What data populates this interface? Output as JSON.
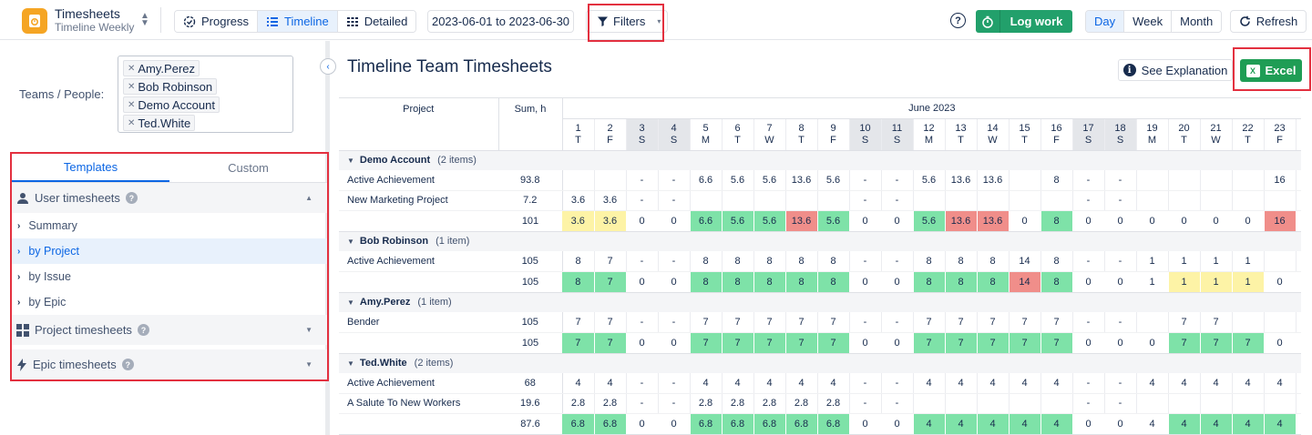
{
  "app": {
    "title": "Timesheets",
    "subtitle": "Timeline Weekly"
  },
  "views": [
    {
      "label": "Progress",
      "active": false
    },
    {
      "label": "Timeline",
      "active": true
    },
    {
      "label": "Detailed",
      "active": false
    }
  ],
  "date_range": "2023-06-01 to 2023-06-30",
  "filters_label": "Filters",
  "log_work_label": "Log work",
  "periods": [
    {
      "label": "Day",
      "active": true
    },
    {
      "label": "Week",
      "active": false
    },
    {
      "label": "Month",
      "active": false
    }
  ],
  "refresh_label": "Refresh",
  "teams_label": "Teams / People:",
  "people": [
    "Amy.Perez",
    "Bob Robinson",
    "Demo Account",
    "Ted.White"
  ],
  "tabs": [
    {
      "label": "Templates",
      "active": true
    },
    {
      "label": "Custom",
      "active": false
    }
  ],
  "groups": {
    "user": "User timesheets",
    "project": "Project timesheets",
    "epic": "Epic timesheets"
  },
  "template_items": [
    {
      "label": "Summary",
      "active": false
    },
    {
      "label": "by Project",
      "active": true
    },
    {
      "label": "by Issue",
      "active": false
    },
    {
      "label": "by Epic",
      "active": false
    }
  ],
  "main": {
    "title": "Timeline Team Timesheets",
    "see_explanation": "See Explanation",
    "excel_label": "Excel"
  },
  "grid": {
    "project_header": "Project",
    "sum_header": "Sum, h",
    "month": "June 2023",
    "days": [
      {
        "d": "1",
        "w": "T",
        "we": false
      },
      {
        "d": "2",
        "w": "F",
        "we": false
      },
      {
        "d": "3",
        "w": "S",
        "we": true
      },
      {
        "d": "4",
        "w": "S",
        "we": true
      },
      {
        "d": "5",
        "w": "M",
        "we": false
      },
      {
        "d": "6",
        "w": "T",
        "we": false
      },
      {
        "d": "7",
        "w": "W",
        "we": false
      },
      {
        "d": "8",
        "w": "T",
        "we": false
      },
      {
        "d": "9",
        "w": "F",
        "we": false
      },
      {
        "d": "10",
        "w": "S",
        "we": true
      },
      {
        "d": "11",
        "w": "S",
        "we": true
      },
      {
        "d": "12",
        "w": "M",
        "we": false
      },
      {
        "d": "13",
        "w": "T",
        "we": false
      },
      {
        "d": "14",
        "w": "W",
        "we": false
      },
      {
        "d": "15",
        "w": "T",
        "we": false
      },
      {
        "d": "16",
        "w": "F",
        "we": false
      },
      {
        "d": "17",
        "w": "S",
        "we": true
      },
      {
        "d": "18",
        "w": "S",
        "we": true
      },
      {
        "d": "19",
        "w": "M",
        "we": false
      },
      {
        "d": "20",
        "w": "T",
        "we": false
      },
      {
        "d": "21",
        "w": "W",
        "we": false
      },
      {
        "d": "22",
        "w": "T",
        "we": false
      },
      {
        "d": "23",
        "w": "F",
        "we": false
      }
    ],
    "sections": [
      {
        "name": "Demo Account",
        "count": "(2 items)",
        "rows": [
          {
            "project": "Active Achievement",
            "sum": "93.8",
            "cells": [
              "",
              "",
              "-",
              "-",
              "6.6",
              "5.6",
              "5.6",
              "13.6",
              "5.6",
              "-",
              "-",
              "5.6",
              "13.6",
              "13.6",
              "",
              "8",
              "-",
              "-",
              "",
              "",
              "",
              "",
              "16"
            ]
          },
          {
            "project": "New Marketing Project",
            "sum": "7.2",
            "cells": [
              "3.6",
              "3.6",
              "-",
              "-",
              "",
              "",
              "",
              "",
              "",
              "-",
              "-",
              "",
              "",
              "",
              "",
              "",
              "-",
              "-",
              "",
              "",
              "",
              "",
              ""
            ]
          }
        ],
        "total": {
          "sum": "101",
          "cells": [
            {
              "v": "3.6",
              "c": "yellow"
            },
            {
              "v": "3.6",
              "c": "yellow"
            },
            {
              "v": "0",
              "c": ""
            },
            {
              "v": "0",
              "c": ""
            },
            {
              "v": "6.6",
              "c": "green"
            },
            {
              "v": "5.6",
              "c": "green"
            },
            {
              "v": "5.6",
              "c": "green"
            },
            {
              "v": "13.6",
              "c": "red"
            },
            {
              "v": "5.6",
              "c": "green"
            },
            {
              "v": "0",
              "c": ""
            },
            {
              "v": "0",
              "c": ""
            },
            {
              "v": "5.6",
              "c": "green"
            },
            {
              "v": "13.6",
              "c": "red"
            },
            {
              "v": "13.6",
              "c": "red"
            },
            {
              "v": "0",
              "c": ""
            },
            {
              "v": "8",
              "c": "green"
            },
            {
              "v": "0",
              "c": ""
            },
            {
              "v": "0",
              "c": ""
            },
            {
              "v": "0",
              "c": ""
            },
            {
              "v": "0",
              "c": ""
            },
            {
              "v": "0",
              "c": ""
            },
            {
              "v": "0",
              "c": ""
            },
            {
              "v": "16",
              "c": "red"
            }
          ]
        }
      },
      {
        "name": "Bob Robinson",
        "count": "(1 item)",
        "rows": [
          {
            "project": "Active Achievement",
            "sum": "105",
            "cells": [
              "8",
              "7",
              "-",
              "-",
              "8",
              "8",
              "8",
              "8",
              "8",
              "-",
              "-",
              "8",
              "8",
              "8",
              "14",
              "8",
              "-",
              "-",
              "1",
              "1",
              "1",
              "1",
              ""
            ]
          }
        ],
        "total": {
          "sum": "105",
          "cells": [
            {
              "v": "8",
              "c": "green"
            },
            {
              "v": "7",
              "c": "green"
            },
            {
              "v": "0",
              "c": ""
            },
            {
              "v": "0",
              "c": ""
            },
            {
              "v": "8",
              "c": "green"
            },
            {
              "v": "8",
              "c": "green"
            },
            {
              "v": "8",
              "c": "green"
            },
            {
              "v": "8",
              "c": "green"
            },
            {
              "v": "8",
              "c": "green"
            },
            {
              "v": "0",
              "c": ""
            },
            {
              "v": "0",
              "c": ""
            },
            {
              "v": "8",
              "c": "green"
            },
            {
              "v": "8",
              "c": "green"
            },
            {
              "v": "8",
              "c": "green"
            },
            {
              "v": "14",
              "c": "red"
            },
            {
              "v": "8",
              "c": "green"
            },
            {
              "v": "0",
              "c": ""
            },
            {
              "v": "0",
              "c": ""
            },
            {
              "v": "1",
              "c": ""
            },
            {
              "v": "1",
              "c": "yellow"
            },
            {
              "v": "1",
              "c": "yellow"
            },
            {
              "v": "1",
              "c": "yellow"
            },
            {
              "v": "0",
              "c": ""
            }
          ]
        }
      },
      {
        "name": "Amy.Perez",
        "count": "(1 item)",
        "rows": [
          {
            "project": "Bender",
            "sum": "105",
            "cells": [
              "7",
              "7",
              "-",
              "-",
              "7",
              "7",
              "7",
              "7",
              "7",
              "-",
              "-",
              "7",
              "7",
              "7",
              "7",
              "7",
              "-",
              "-",
              "",
              "7",
              "7",
              "",
              ""
            ]
          }
        ],
        "total": {
          "sum": "105",
          "cells": [
            {
              "v": "7",
              "c": "green"
            },
            {
              "v": "7",
              "c": "green"
            },
            {
              "v": "0",
              "c": ""
            },
            {
              "v": "0",
              "c": ""
            },
            {
              "v": "7",
              "c": "green"
            },
            {
              "v": "7",
              "c": "green"
            },
            {
              "v": "7",
              "c": "green"
            },
            {
              "v": "7",
              "c": "green"
            },
            {
              "v": "7",
              "c": "green"
            },
            {
              "v": "0",
              "c": ""
            },
            {
              "v": "0",
              "c": ""
            },
            {
              "v": "7",
              "c": "green"
            },
            {
              "v": "7",
              "c": "green"
            },
            {
              "v": "7",
              "c": "green"
            },
            {
              "v": "7",
              "c": "green"
            },
            {
              "v": "7",
              "c": "green"
            },
            {
              "v": "0",
              "c": ""
            },
            {
              "v": "0",
              "c": ""
            },
            {
              "v": "0",
              "c": ""
            },
            {
              "v": "7",
              "c": "green"
            },
            {
              "v": "7",
              "c": "green"
            },
            {
              "v": "7",
              "c": "green"
            },
            {
              "v": "0",
              "c": ""
            }
          ]
        }
      },
      {
        "name": "Ted.White",
        "count": "(2 items)",
        "rows": [
          {
            "project": "Active Achievement",
            "sum": "68",
            "cells": [
              "4",
              "4",
              "-",
              "-",
              "4",
              "4",
              "4",
              "4",
              "4",
              "-",
              "-",
              "4",
              "4",
              "4",
              "4",
              "4",
              "-",
              "-",
              "4",
              "4",
              "4",
              "4",
              "4"
            ]
          },
          {
            "project": "A Salute To New Workers",
            "sum": "19.6",
            "cells": [
              "2.8",
              "2.8",
              "-",
              "-",
              "2.8",
              "2.8",
              "2.8",
              "2.8",
              "2.8",
              "-",
              "-",
              "",
              "",
              "",
              "",
              "",
              "-",
              "-",
              "",
              "",
              "",
              "",
              ""
            ]
          }
        ],
        "total": {
          "sum": "87.6",
          "cells": [
            {
              "v": "6.8",
              "c": "green"
            },
            {
              "v": "6.8",
              "c": "green"
            },
            {
              "v": "0",
              "c": ""
            },
            {
              "v": "0",
              "c": ""
            },
            {
              "v": "6.8",
              "c": "green"
            },
            {
              "v": "6.8",
              "c": "green"
            },
            {
              "v": "6.8",
              "c": "green"
            },
            {
              "v": "6.8",
              "c": "green"
            },
            {
              "v": "6.8",
              "c": "green"
            },
            {
              "v": "0",
              "c": ""
            },
            {
              "v": "0",
              "c": ""
            },
            {
              "v": "4",
              "c": "green"
            },
            {
              "v": "4",
              "c": "green"
            },
            {
              "v": "4",
              "c": "green"
            },
            {
              "v": "4",
              "c": "green"
            },
            {
              "v": "4",
              "c": "green"
            },
            {
              "v": "0",
              "c": ""
            },
            {
              "v": "0",
              "c": ""
            },
            {
              "v": "4",
              "c": ""
            },
            {
              "v": "4",
              "c": "green"
            },
            {
              "v": "4",
              "c": "green"
            },
            {
              "v": "4",
              "c": "green"
            },
            {
              "v": "4",
              "c": "green"
            }
          ]
        }
      }
    ]
  }
}
